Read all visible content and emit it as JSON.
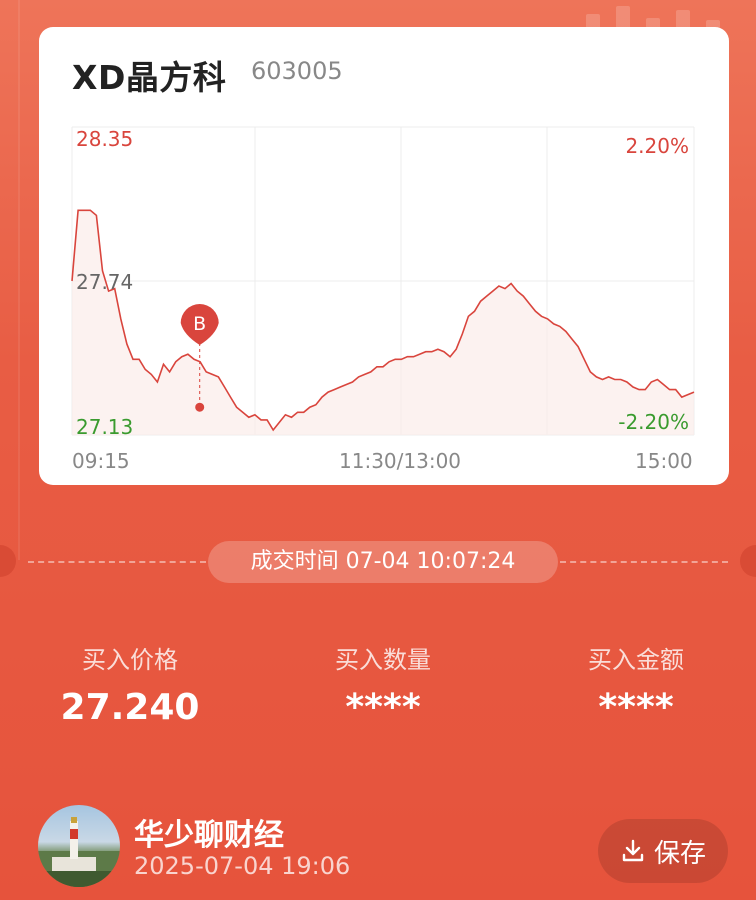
{
  "stock": {
    "name": "XD晶方科",
    "code": "603005"
  },
  "chart_data": {
    "type": "line",
    "title": "",
    "y_left_labels": {
      "high": "28.35",
      "mid": "27.74",
      "low": "27.13"
    },
    "y_right_labels": {
      "high": "2.20%",
      "low": "-2.20%"
    },
    "ylim": [
      27.13,
      28.35
    ],
    "x_labels": [
      "09:15",
      "11:30/13:00",
      "15:00"
    ],
    "series": [
      {
        "values": [
          27.74,
          28.02,
          28.02,
          28.02,
          28.0,
          27.78,
          27.7,
          27.71,
          27.59,
          27.49,
          27.43,
          27.43,
          27.39,
          27.37,
          27.34,
          27.41,
          27.38,
          27.42,
          27.44,
          27.45,
          27.43,
          27.42,
          27.38,
          27.37,
          27.36,
          27.32,
          27.28,
          27.24,
          27.22,
          27.2,
          27.21,
          27.19,
          27.19,
          27.15,
          27.18,
          27.21,
          27.2,
          27.22,
          27.22,
          27.24,
          27.25,
          27.28,
          27.3,
          27.31,
          27.32,
          27.33,
          27.34,
          27.36,
          27.37,
          27.38,
          27.4,
          27.4,
          27.42,
          27.43,
          27.43,
          27.44,
          27.44,
          27.45,
          27.46,
          27.46,
          27.47,
          27.46,
          27.44,
          27.47,
          27.53,
          27.6,
          27.62,
          27.66,
          27.68,
          27.7,
          27.72,
          27.71,
          27.73,
          27.7,
          27.68,
          27.65,
          27.62,
          27.6,
          27.59,
          27.57,
          27.56,
          27.54,
          27.51,
          27.48,
          27.43,
          27.38,
          27.36,
          27.35,
          27.36,
          27.35,
          27.35,
          27.34,
          27.32,
          27.31,
          27.31,
          27.34,
          27.35,
          27.33,
          27.31,
          27.31,
          27.28,
          27.29,
          27.3
        ],
        "color": "#d9453d"
      }
    ],
    "marker": {
      "label": "B",
      "price": 27.24,
      "time": "10:07:24"
    }
  },
  "trade_time": "成交时间 07-04 10:07:24",
  "stats": [
    {
      "label": "买入价格",
      "value": "27.240"
    },
    {
      "label": "买入数量",
      "value": "****"
    },
    {
      "label": "买入金额",
      "value": "****"
    }
  ],
  "author": {
    "name": "华少聊财经",
    "date": "2025-07-04 19:06"
  },
  "save_label": "保存",
  "colors": {
    "up": "#d9453d",
    "down": "#3a9b2f",
    "accent": "#e6533c"
  }
}
